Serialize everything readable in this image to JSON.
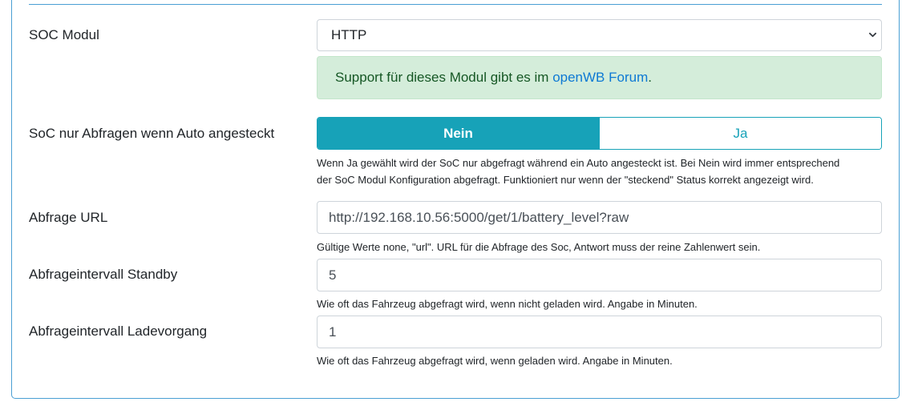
{
  "soc_modul": {
    "label": "SOC Modul",
    "selected": "HTTP"
  },
  "support_alert": {
    "text": "Support für dieses Modul gibt es im ",
    "link": "openWB Forum",
    "suffix": "."
  },
  "soc_plugged": {
    "label": "SoC nur Abfragen wenn Auto angesteckt",
    "options": [
      "Nein",
      "Ja"
    ],
    "selected": "Nein",
    "help_line1": "Wenn Ja gewählt wird der SoC nur abgefragt während ein Auto angesteckt ist. Bei Nein wird immer entsprechend",
    "help_line2": "der SoC Modul Konfiguration abgefragt. Funktioniert nur wenn der \"steckend\" Status korrekt angezeigt wird."
  },
  "abfrage_url": {
    "label": "Abfrage URL",
    "value": "http://192.168.10.56:5000/get/1/battery_level?raw",
    "help": "Gültige Werte none, \"url\". URL für die Abfrage des Soc, Antwort muss der reine Zahlenwert sein."
  },
  "interval_standby": {
    "label": "Abfrageintervall Standby",
    "value": "5",
    "help": "Wie oft das Fahrzeug abgefragt wird, wenn nicht geladen wird. Angabe in Minuten."
  },
  "interval_charging": {
    "label": "Abfrageintervall Ladevorgang",
    "value": "1",
    "help": "Wie oft das Fahrzeug abgefragt wird, wenn geladen wird. Angabe in Minuten."
  },
  "colors": {
    "accent": "#17a2b8",
    "alert_bg": "#d4edda",
    "alert_text": "#155724",
    "link": "#0d79d4",
    "card_border": "#4a9fd4"
  },
  "icons": {
    "select_arrow": "chevron-down-icon"
  }
}
